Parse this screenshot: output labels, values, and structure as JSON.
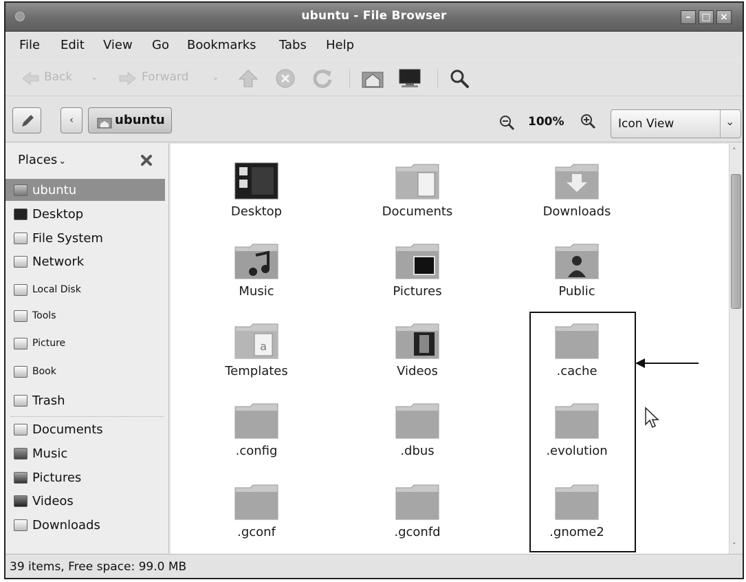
{
  "window": {
    "title": "ubuntu - File Browser"
  },
  "menubar": {
    "items": [
      "File",
      "Edit",
      "View",
      "Go",
      "Bookmarks",
      "Tabs",
      "Help"
    ]
  },
  "toolbar": {
    "back_label": "Back",
    "forward_label": "Forward",
    "icons": [
      "up-icon",
      "stop-icon",
      "reload-icon",
      "home-icon",
      "computer-icon",
      "search-icon"
    ]
  },
  "location": {
    "breadcrumb": "ubuntu",
    "zoom": "100%",
    "view_mode": "Icon View"
  },
  "sidebar": {
    "header": "Places",
    "items": [
      {
        "label": "ubuntu",
        "selected": true,
        "small": false
      },
      {
        "label": "Desktop",
        "small": false
      },
      {
        "label": "File System",
        "small": false
      },
      {
        "label": "Network",
        "small": false
      },
      {
        "label": "Local Disk",
        "small": true
      },
      {
        "label": "Tools",
        "small": true
      },
      {
        "label": "Picture",
        "small": true
      },
      {
        "label": "Book",
        "small": true
      },
      {
        "label": "Trash",
        "small": false
      },
      {
        "label": "Documents",
        "small": false
      },
      {
        "label": "Music",
        "small": false
      },
      {
        "label": "Pictures",
        "small": false
      },
      {
        "label": "Videos",
        "small": false
      },
      {
        "label": "Downloads",
        "small": false
      }
    ]
  },
  "files": [
    {
      "name": "Desktop",
      "kind": "desktop"
    },
    {
      "name": "Documents",
      "kind": "documents"
    },
    {
      "name": "Downloads",
      "kind": "downloads"
    },
    {
      "name": "Music",
      "kind": "music"
    },
    {
      "name": "Pictures",
      "kind": "pictures"
    },
    {
      "name": "Public",
      "kind": "public"
    },
    {
      "name": "Templates",
      "kind": "templates"
    },
    {
      "name": "Videos",
      "kind": "videos"
    },
    {
      "name": ".cache",
      "kind": "folder"
    },
    {
      "name": ".config",
      "kind": "folder"
    },
    {
      "name": ".dbus",
      "kind": "folder"
    },
    {
      "name": ".evolution",
      "kind": "folder"
    },
    {
      "name": ".gconf",
      "kind": "folder"
    },
    {
      "name": ".gconfd",
      "kind": "folder"
    },
    {
      "name": ".gnome2",
      "kind": "folder"
    }
  ],
  "status": {
    "text": "39 items, Free space: 99.0 MB"
  }
}
